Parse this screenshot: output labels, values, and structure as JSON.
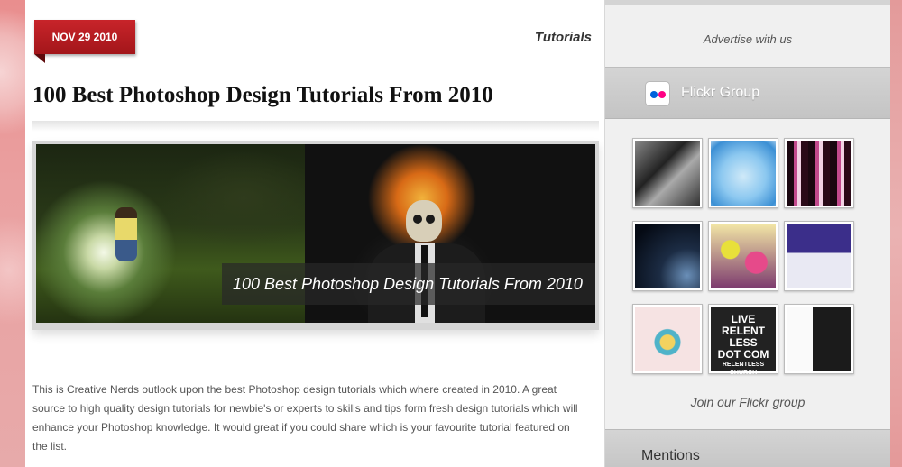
{
  "post": {
    "date": "NOV 29 2010",
    "category": "Tutorials",
    "title": "100 Best Photoshop Design Tutorials From 2010",
    "banner_caption": "100 Best Photoshop Design Tutorials From 2010",
    "excerpt": "This is Creative Nerds outlook upon the best Photoshop design tutorials which where created in 2010. A great source to high quality design tutorials for newbie's or experts to skills and tips form fresh design tutorials which will enhance your Photoshop knowledge. It would great if you could share which is your favourite tutorial featured on the list."
  },
  "sidebar": {
    "advertise": "Advertise with us",
    "flickr": {
      "title": "Flickr Group",
      "icon": "flickr-logo-icon",
      "thumbnail_8_text": [
        "LIVE",
        "RELENT",
        "LESS",
        "DOT COM",
        "RELENTLESS",
        "CHURCH"
      ],
      "join_label": "Join our Flickr group"
    },
    "mentions": {
      "title": "Mentions"
    }
  },
  "colors": {
    "date_ribbon": "#b51d22",
    "flickr_blue": "#0063dc",
    "flickr_pink": "#ff0084",
    "background_pink": "#e9a5a5"
  }
}
